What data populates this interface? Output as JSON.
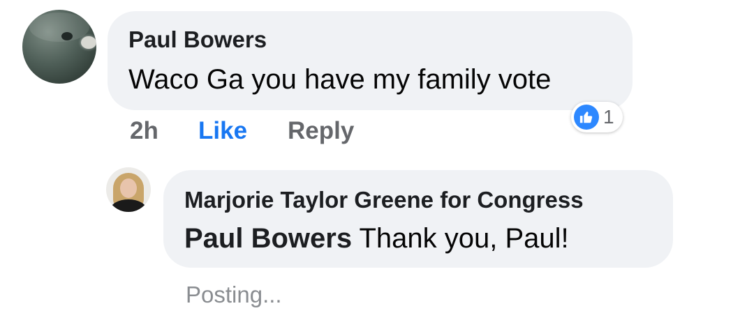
{
  "comment": {
    "author": "Paul Bowers",
    "text": "Waco Ga you have my family vote",
    "timestamp": "2h",
    "like_label": "Like",
    "reply_label": "Reply",
    "reaction": {
      "icon": "thumbs-up-icon",
      "count": "1",
      "color": "#2d88ff"
    }
  },
  "reply": {
    "author": "Marjorie Taylor Greene for Congress",
    "mention": "Paul Bowers",
    "text": " Thank you, Paul!",
    "status": "Posting..."
  },
  "colors": {
    "bubble": "#f0f2f5",
    "link_blue": "#1877f2",
    "muted": "#65676b"
  }
}
